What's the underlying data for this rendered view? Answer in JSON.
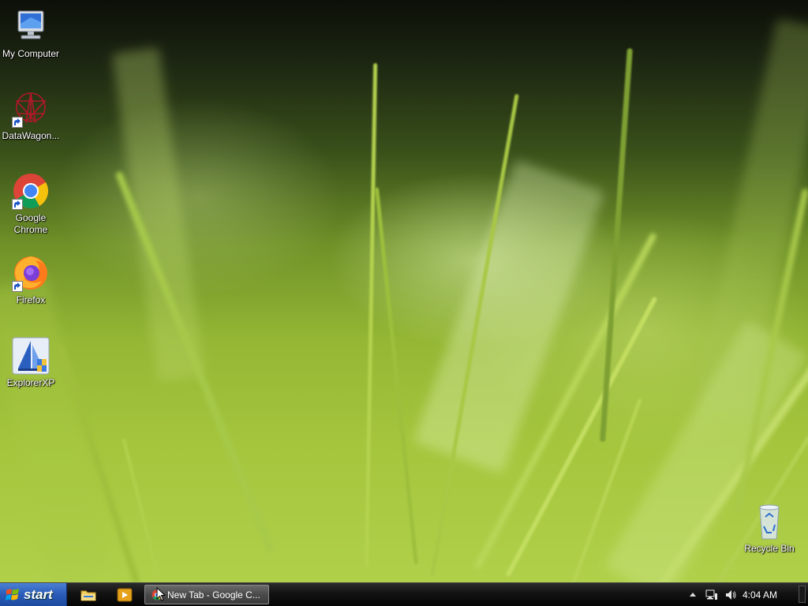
{
  "desktop": {
    "icons": [
      {
        "label": "My Computer",
        "icon": "my-computer-icon"
      },
      {
        "label": "DataWagon...",
        "icon": "datawagon-icon"
      },
      {
        "label": "Google Chrome",
        "icon": "chrome-icon"
      },
      {
        "label": "Firefox",
        "icon": "firefox-icon"
      },
      {
        "label": "ExplorerXP",
        "icon": "explorerxp-icon"
      },
      {
        "label": "Recycle Bin",
        "icon": "recycle-bin-icon"
      }
    ]
  },
  "taskbar": {
    "start_label": "start",
    "quick_launch": [
      "file-explorer-icon",
      "media-player-icon"
    ],
    "tasks": [
      {
        "label": "New Tab - Google C...",
        "icon": "chrome-icon"
      }
    ],
    "tray": {
      "clock": "4:04 AM",
      "icons": [
        "show-hidden-icon",
        "network-icon",
        "volume-icon"
      ]
    }
  }
}
